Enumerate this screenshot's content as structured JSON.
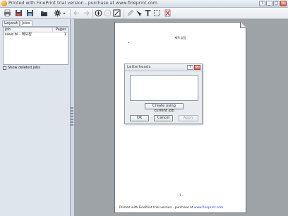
{
  "window": {
    "title": "Printed with FinePrint trial version - purchase at www.fineprint.com",
    "buttons": [
      "?",
      "_",
      "□",
      "×"
    ]
  },
  "toolbar": {
    "icons": [
      "print-icon",
      "save-icon",
      "floppy-icon",
      "folder-icon",
      "settings-icon",
      "back-icon",
      "forward-icon",
      "zoom-in-icon",
      "zoom-out-icon",
      "fit-page-icon",
      "pencil-icon",
      "highlighter-icon",
      "text-icon",
      "select-icon",
      "delete-icon"
    ]
  },
  "left_panel": {
    "tabs": [
      "Layout",
      "Jobs"
    ],
    "active_tab": "Jobs",
    "jobs": {
      "columns": [
        "Job",
        "Pages"
      ],
      "rows": [
        {
          "job": "save bl - 메모장",
          "pages": "1"
        }
      ]
    },
    "show_deleted_label": "Show deleted jobs"
  },
  "document": {
    "header": "제목 없음",
    "marker": "•",
    "page_number": "- 1 -",
    "footer_text": "Printed with FinePrint trial version - purchase at",
    "footer_link": "www.fineprint.com"
  },
  "dialog": {
    "title": "Letterheads",
    "create_label": "Create using current job",
    "ok_label": "OK",
    "cancel_label": "Cancel",
    "apply_label": "Apply"
  },
  "colors": {
    "accent": "#e07b00",
    "close": "#d9654c",
    "link": "#1e3cd0"
  }
}
